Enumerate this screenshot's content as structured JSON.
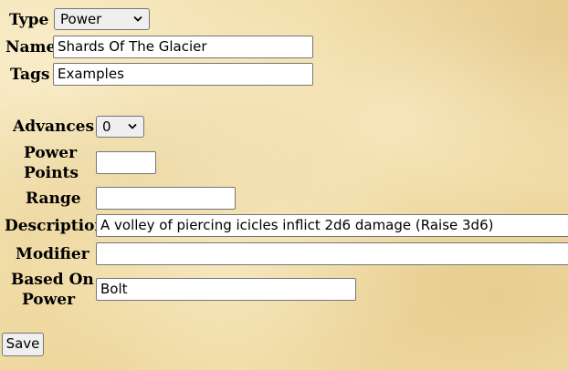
{
  "form": {
    "type": {
      "label": "Type",
      "value": "Power"
    },
    "name": {
      "label": "Name",
      "value": "Shards Of The Glacier"
    },
    "tags": {
      "label": "Tags",
      "value": "Examples"
    },
    "advances": {
      "label": "Advances",
      "value": "0"
    },
    "power_points": {
      "label_line1": "Power",
      "label_line2": "Points",
      "value": ""
    },
    "range": {
      "label": "Range",
      "value": ""
    },
    "description": {
      "label": "Description",
      "value": "A volley of piercing icicles inflict 2d6 damage (Raise 3d6)"
    },
    "modifier": {
      "label": "Modifier",
      "value": ""
    },
    "based_on_power": {
      "label_line1": "Based On",
      "label_line2": "Power",
      "value": "Bolt"
    }
  },
  "actions": {
    "save_label": "Save"
  },
  "icons": {
    "dropdown": "chevron-down-icon"
  }
}
